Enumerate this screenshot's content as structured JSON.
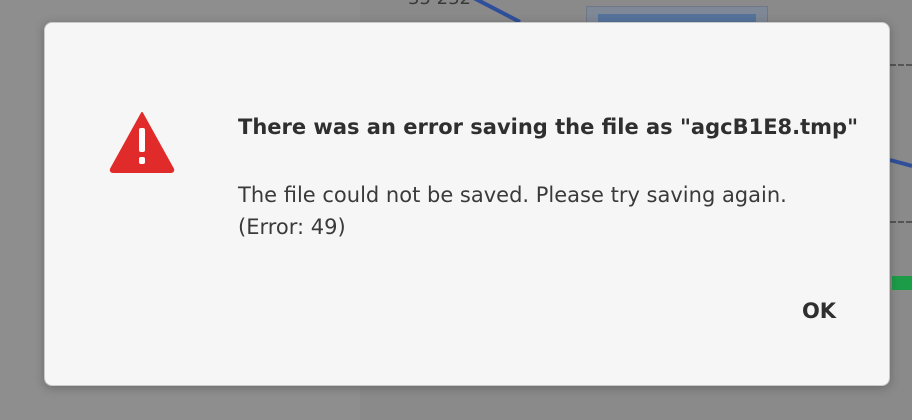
{
  "background": {
    "partial_number": "35 232"
  },
  "dialog": {
    "icon": "warning-icon",
    "icon_color": "#e12b2b",
    "title": "There was an error saving the file as \"agcB1E8.tmp\"",
    "message_line1": "The file could not be saved. Please try saving again.",
    "message_line2": "(Error: 49)",
    "ok_label": "OK"
  }
}
